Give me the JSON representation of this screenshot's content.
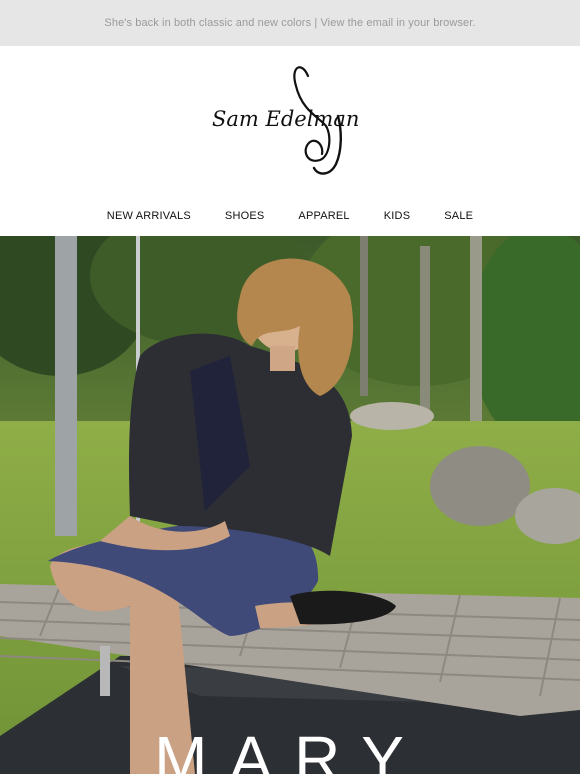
{
  "preheader": {
    "text": "She's back in both classic and new colors | View the email in your browser."
  },
  "brand": {
    "logo_text": "Sam Edelman",
    "logo_icon": "sam-edelman-script-logo"
  },
  "nav": {
    "items": [
      "NEW ARRIVALS",
      "SHOES",
      "APPAREL",
      "KIDS",
      "SALE"
    ]
  },
  "hero": {
    "image": "woman-seated-on-bench-in-garden",
    "title": "MARY"
  },
  "colors": {
    "preheader_bg": "#e6e6e6",
    "preheader_text": "#9a9a9a",
    "nav_text": "#111111",
    "hero_title": "#ffffff"
  }
}
